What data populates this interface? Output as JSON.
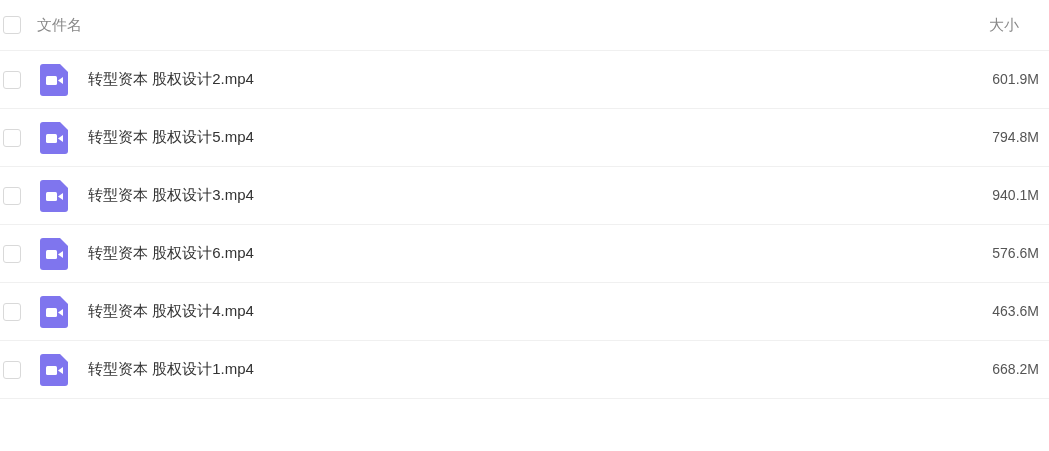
{
  "header": {
    "checked": false,
    "name_label": "文件名",
    "size_label": "大小"
  },
  "files": [
    {
      "name": "转型资本 股权设计2.mp4",
      "size": "601.9M",
      "checked": false
    },
    {
      "name": "转型资本 股权设计5.mp4",
      "size": "794.8M",
      "checked": false
    },
    {
      "name": "转型资本 股权设计3.mp4",
      "size": "940.1M",
      "checked": false
    },
    {
      "name": "转型资本 股权设计6.mp4",
      "size": "576.6M",
      "checked": false
    },
    {
      "name": "转型资本 股权设计4.mp4",
      "size": "463.6M",
      "checked": false
    },
    {
      "name": "转型资本 股权设计1.mp4",
      "size": "668.2M",
      "checked": false
    }
  ]
}
